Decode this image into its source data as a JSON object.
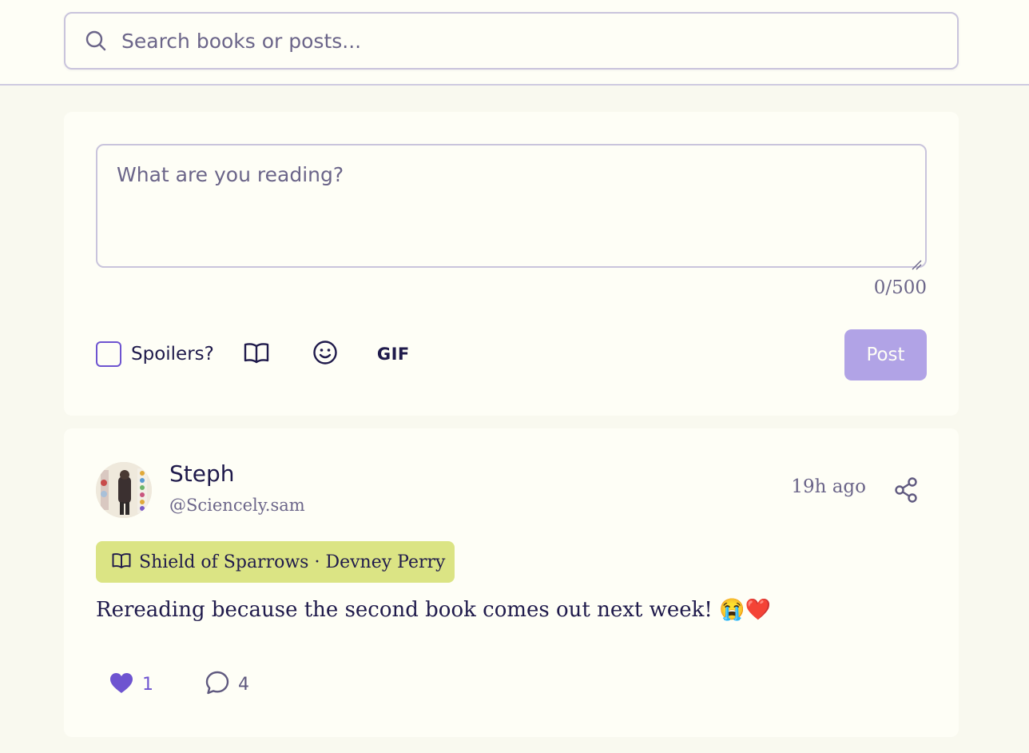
{
  "search": {
    "placeholder": "Search books or posts..."
  },
  "composer": {
    "placeholder": "What are you reading?",
    "counter": "0/500",
    "spoilers_label": "Spoilers?",
    "book_icon": "book-open-icon",
    "emoji_icon": "smiley-icon",
    "gif_label": "GIF",
    "post_label": "Post"
  },
  "post": {
    "author_name": "Steph",
    "author_handle": "@Sciencely.sam",
    "timestamp": "19h ago",
    "book_tag": "Shield of Sparrows · Devney Perry",
    "text": "Rereading because the second book comes out next week! 😭❤️",
    "likes": "1",
    "comments": "4"
  },
  "colors": {
    "accent": "#6e54d0",
    "post_button": "#b1a3e6",
    "book_tag_bg": "#dbe484",
    "text_primary": "#1f1a4b",
    "text_muted": "#6b6589",
    "background": "#f9f9ef",
    "card": "#fefef6"
  }
}
